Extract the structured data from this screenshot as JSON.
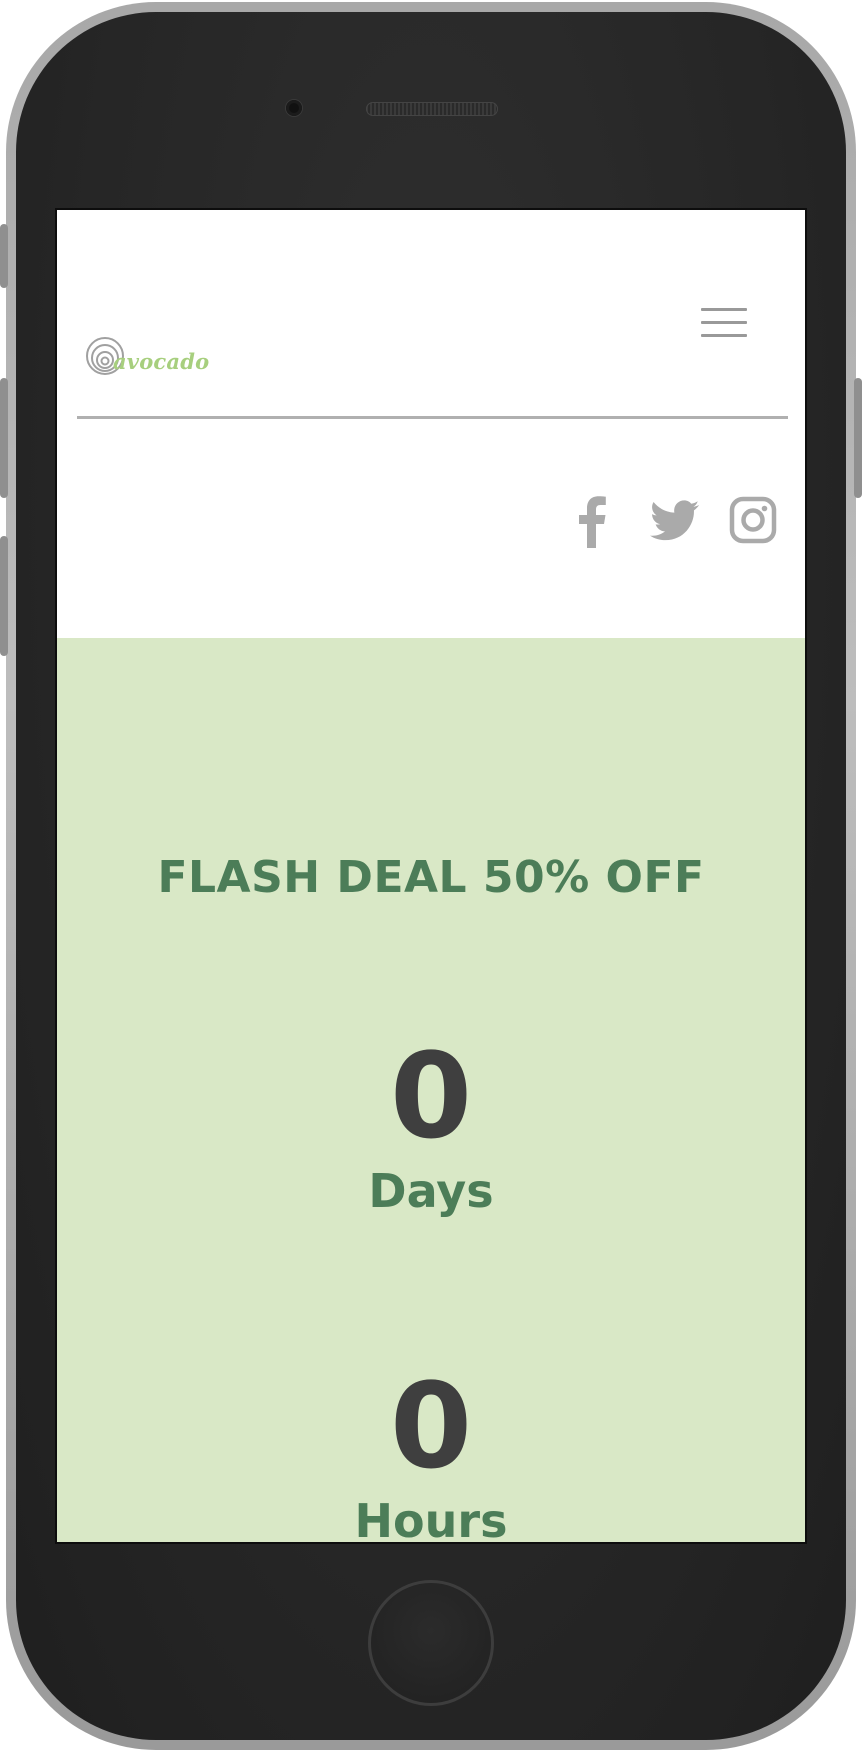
{
  "brand": {
    "logo_text": "avocado",
    "logo_color": "#a7cf7e"
  },
  "header": {
    "menu_icon": "hamburger-menu-icon",
    "social": [
      {
        "name": "facebook",
        "icon": "facebook-icon"
      },
      {
        "name": "twitter",
        "icon": "twitter-icon"
      },
      {
        "name": "instagram",
        "icon": "instagram-icon"
      }
    ]
  },
  "promo": {
    "title": "FLASH DEAL 50% OFF",
    "background": "#d9e8c6",
    "accent": "#4c7d58"
  },
  "countdown": {
    "days_value": "0",
    "days_label": "Days",
    "hours_value": "0",
    "hours_label": "Hours"
  }
}
